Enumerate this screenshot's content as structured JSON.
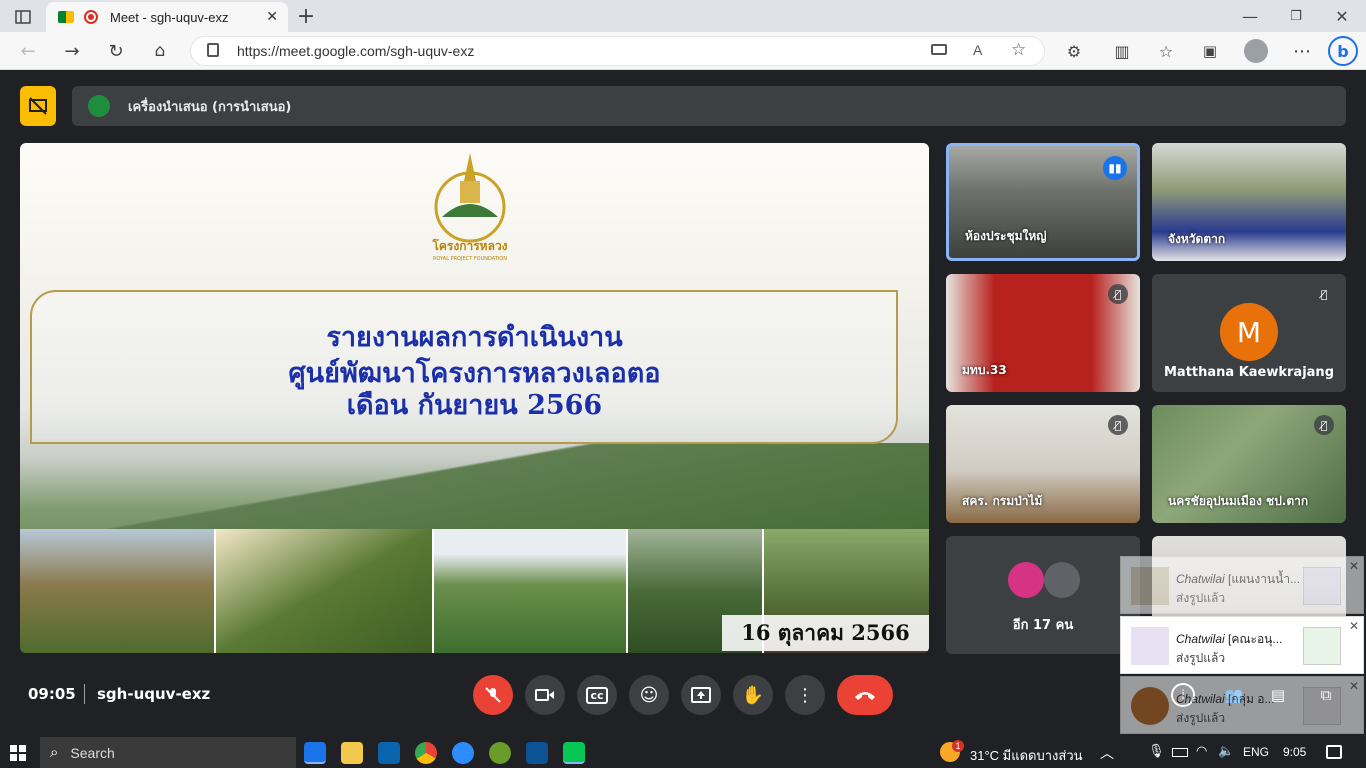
{
  "browser": {
    "tab_title": "Meet - sgh-uquv-exz",
    "url": "https://meet.google.com/sgh-uquv-exz"
  },
  "presenter_banner": "เครื่องนำเสนอ (การนำเสนอ)",
  "slide": {
    "logo_text": "โครงการหลวง",
    "logo_subtext": "ROYAL PROJECT FOUNDATION",
    "title_line1": "รายงานผลการดำเนินงาน",
    "title_line2": "ศูนย์พัฒนาโครงการหลวงเลอตอ",
    "title_line3": "เดือน  กันยายน  2566",
    "date_label": "16  ตุลาคม  2566"
  },
  "participants": [
    {
      "name": "ห้องประชุมใหญ่",
      "speaking": true
    },
    {
      "name": "จังหวัดตาก"
    },
    {
      "name": "มทบ.33",
      "muted": true
    },
    {
      "name": "Matthana Kaewkrajang",
      "avatar_letter": "M",
      "muted": true,
      "avatar_color": "#e8710a"
    },
    {
      "name": "สคร. กรมป่าไม้",
      "muted": true
    },
    {
      "name": "นครชัยอุปนมเมือง ชป.ตาก",
      "muted": true
    }
  ],
  "others_label": "อีก 17 คน",
  "meeting_info": {
    "time": "09:05",
    "code": "sgh-uquv-exz"
  },
  "notifications": [
    {
      "sender": "Chatwilai",
      "preview": "[แผนงานน้ำ...",
      "status": "ส่งรูปแล้ว"
    },
    {
      "sender": "Chatwilai",
      "preview": "[คณะอนุ...",
      "status": "ส่งรูปแล้ว"
    },
    {
      "sender": "Chatwilai",
      "preview": "[กลุ่ม อ...",
      "status": "ส่งรูปแล้ว"
    }
  ],
  "taskbar": {
    "search_label": "Search",
    "weather": "31°C  มีแดดบางส่วน",
    "lang": "ENG",
    "clock": "9:05",
    "weather_badge": "1"
  },
  "colors": {
    "end_call": "#ea4335",
    "speaking_border": "#8ab4f8",
    "slide_title": "#1a2fa8"
  }
}
